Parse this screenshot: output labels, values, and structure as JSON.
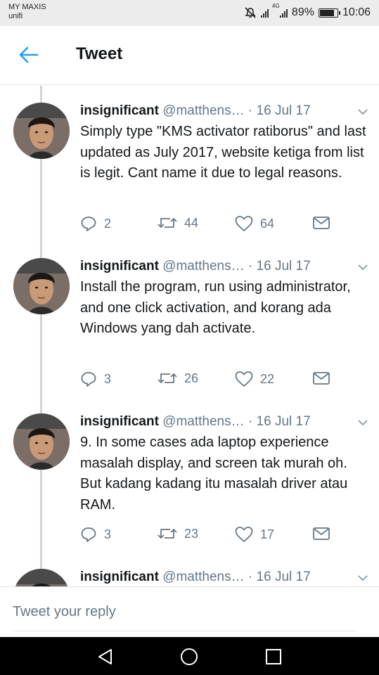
{
  "status_bar": {
    "carrier": "MY MAXIS",
    "network": "unifi",
    "network_type": "4G",
    "battery": "89%",
    "battery_level": 0.89,
    "time": "10:06",
    "icons": [
      "mute-icon",
      "signal-icon",
      "signal-4g-icon",
      "battery-icon"
    ]
  },
  "header": {
    "title": "Tweet",
    "back_icon": "arrow-left-icon"
  },
  "tweets": [
    {
      "name": "insignificant",
      "handle": "@matthens…",
      "sep": " · ",
      "date": "16 Jul 17",
      "text": "Simply type \"KMS activator ratiborus\" and last updated as July 2017, website ketiga from list is legit. Cant name it due to legal reasons.",
      "replies": "2",
      "retweets": "44",
      "likes": "64"
    },
    {
      "name": "insignificant",
      "handle": "@matthens…",
      "sep": " · ",
      "date": "16 Jul 17",
      "text": "Install the program, run using administrator, and one click activation, and korang ada Windows yang dah activate.",
      "replies": "3",
      "retweets": "26",
      "likes": "22"
    },
    {
      "name": "insignificant",
      "handle": "@matthens…",
      "sep": " · ",
      "date": "16 Jul 17",
      "text": "9. In some cases ada laptop experience masalah display, and screen tak murah oh. But kadang kadang itu masalah driver atau RAM.",
      "replies": "3",
      "retweets": "23",
      "likes": "17"
    },
    {
      "name": "insignificant",
      "handle": "@matthens…",
      "sep": " · ",
      "date": "16 Jul 17"
    }
  ],
  "reply": {
    "placeholder": "Tweet your reply"
  },
  "colors": {
    "accent": "#1da1f2",
    "text": "#14171a",
    "secondary": "#657786",
    "thread_line": "#ccd6dd"
  }
}
